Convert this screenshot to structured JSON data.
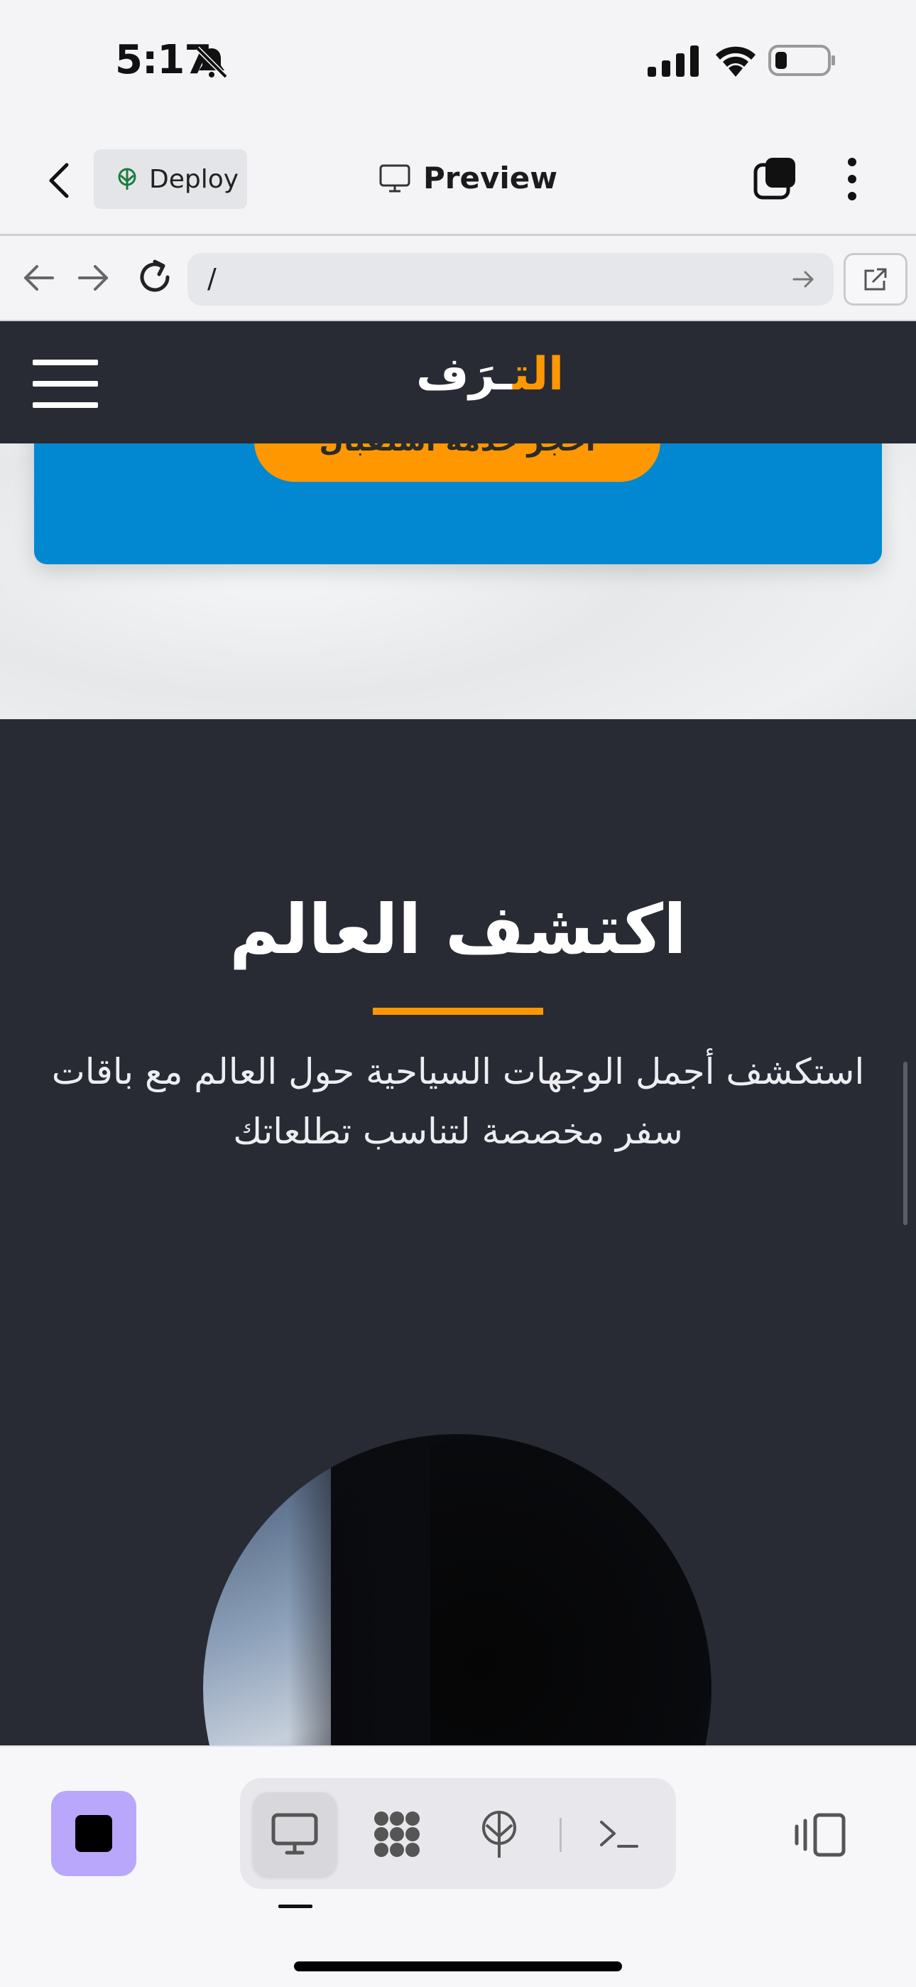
{
  "status_bar": {
    "time": "5:17"
  },
  "app_header": {
    "deploy_label": "Deploy",
    "preview_label": "Preview"
  },
  "url_bar": {
    "url": "/"
  },
  "site": {
    "logo_orange": "الت",
    "logo_white": "ـرَف",
    "cta_button": "احجز خدمة استقبال",
    "discover_title": "اكتشف العالم",
    "discover_text": "استكشف أجمل الوجهات السياحية حول العالم مع باقات سفر مخصصة لتناسب تطلعاتك"
  },
  "colors": {
    "accent_orange": "#ff9800",
    "site_dark": "#282b33",
    "cta_blue": "#0288d1",
    "stop_purple": "#b9a7fb"
  },
  "icons": [
    "bell-slash-icon",
    "signal-icon",
    "wifi-icon",
    "battery-icon",
    "back-chevron-icon",
    "globe-tree-icon",
    "monitor-icon",
    "tabs-icon",
    "kebab-icon",
    "arrow-left-icon",
    "arrow-right-icon",
    "reload-icon",
    "go-arrow-icon",
    "external-link-icon",
    "hamburger-icon",
    "stop-icon",
    "desktop-icon",
    "grid-icon",
    "deploy-icon",
    "terminal-icon",
    "panel-toggle-icon"
  ]
}
